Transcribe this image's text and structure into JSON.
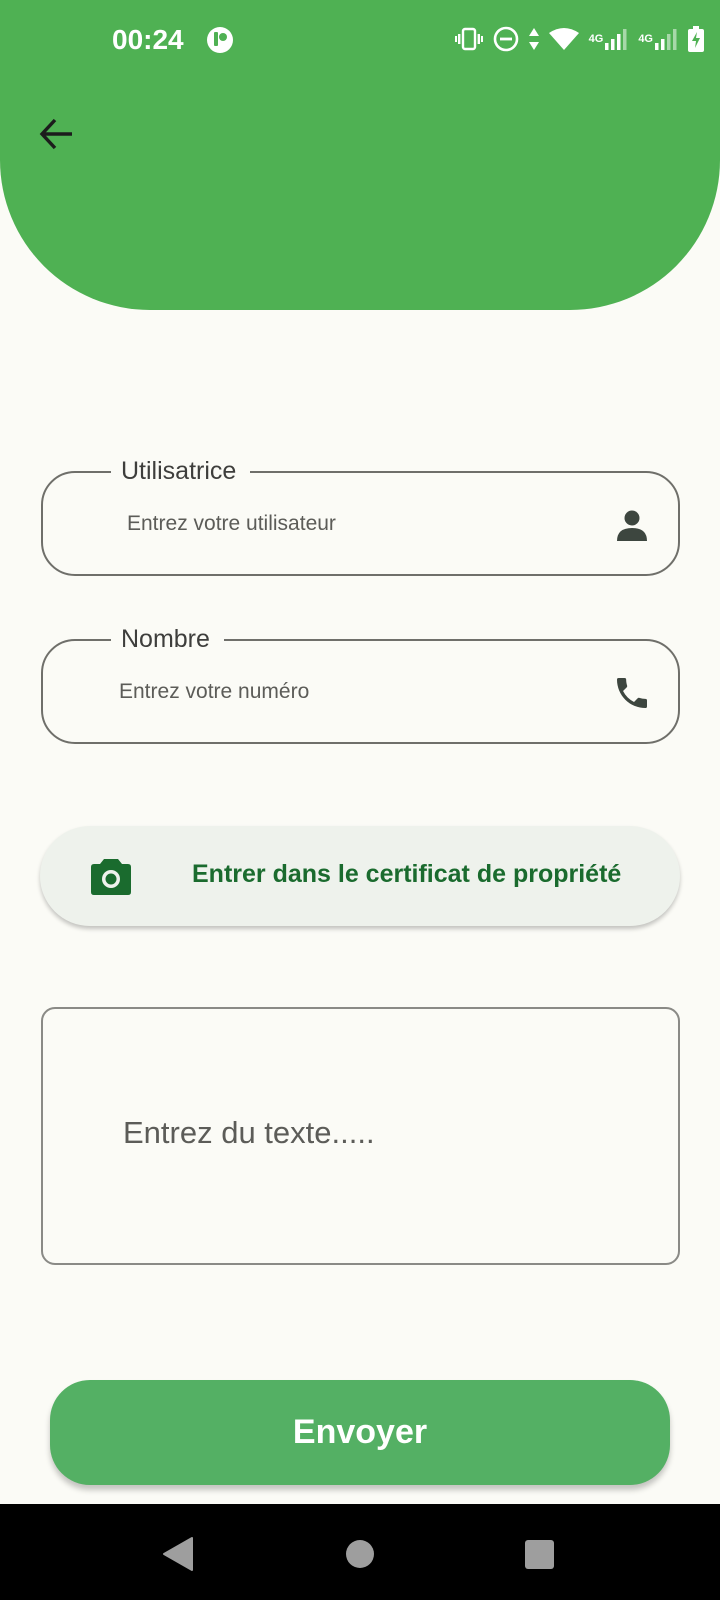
{
  "status_bar": {
    "time": "00:24",
    "network_1": "4G",
    "network_2": "4G",
    "icons": [
      "app-notification-icon",
      "vibrate-icon",
      "do-not-disturb-icon",
      "data-arrows-icon",
      "wifi-icon",
      "signal-icon",
      "signal-icon",
      "battery-charging-icon"
    ]
  },
  "header": {
    "back_icon": "arrow-left-icon",
    "color": "#4fb153"
  },
  "form": {
    "user_field": {
      "label": "Utilisatrice",
      "placeholder": "Entrez votre utilisateur",
      "icon": "person-icon"
    },
    "number_field": {
      "label": "Nombre",
      "placeholder": "Entrez votre numéro",
      "icon": "phone-icon"
    },
    "certificate_button": {
      "label": "Entrer dans le certificat de propriété",
      "icon": "camera-icon",
      "text_color": "#1a6b2e"
    },
    "message_field": {
      "placeholder": "Entrez du texte....."
    },
    "submit_button": {
      "label": "Envoyer",
      "color": "#54b064"
    }
  },
  "nav_bar": {
    "icons": [
      "nav-back-icon",
      "nav-home-icon",
      "nav-recents-icon"
    ]
  }
}
